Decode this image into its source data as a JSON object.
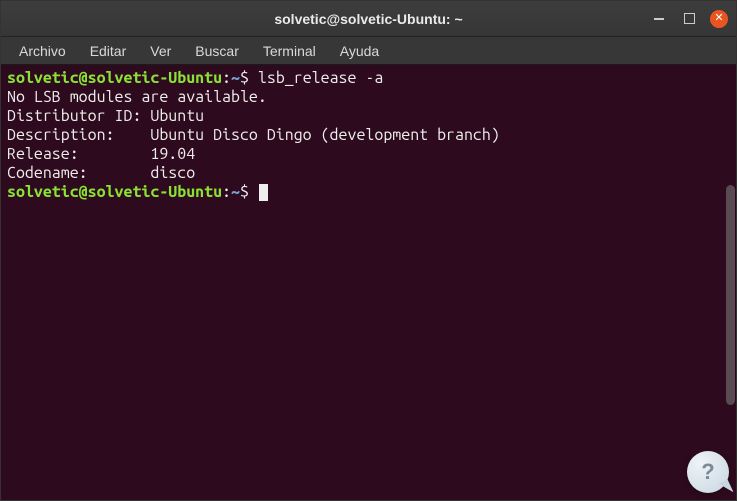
{
  "window": {
    "title": "solvetic@solvetic-Ubuntu: ~"
  },
  "menubar": {
    "items": [
      "Archivo",
      "Editar",
      "Ver",
      "Buscar",
      "Terminal",
      "Ayuda"
    ]
  },
  "terminal": {
    "prompt_user": "solvetic@solvetic-Ubuntu",
    "prompt_path": "~",
    "prompt_dollar": "$",
    "command1": " lsb_release -a",
    "output": [
      "No LSB modules are available.",
      "Distributor ID: Ubuntu",
      "Description:    Ubuntu Disco Dingo (development branch)",
      "Release:        19.04",
      "Codename:       disco"
    ]
  },
  "bubble": {
    "glyph": "?"
  }
}
